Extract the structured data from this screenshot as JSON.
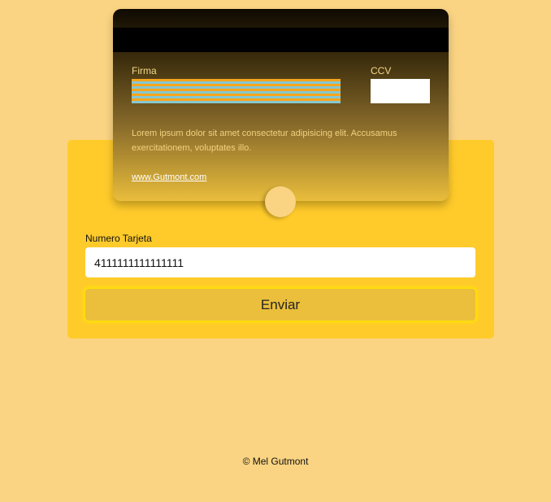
{
  "card": {
    "firma_label": "Firma",
    "ccv_label": "CCV",
    "description": "Lorem ipsum dolor sit amet consectetur adipisicing elit. Accusamus exercitationem, voluptates illo.",
    "link_text": "www.Gutmont.com"
  },
  "form": {
    "card_number_label": "Numero Tarjeta",
    "card_number_value": "4111111111111111",
    "submit_label": "Enviar"
  },
  "footer": {
    "text": "© Mel Gutmont"
  },
  "colors": {
    "background": "#fad482",
    "panel": "#ffcb2b",
    "button": "#ebbf3b",
    "button_glow": "#ffe600",
    "signature_stripe_orange": "#f7a51c",
    "signature_stripe_blue": "#87c7d0"
  }
}
